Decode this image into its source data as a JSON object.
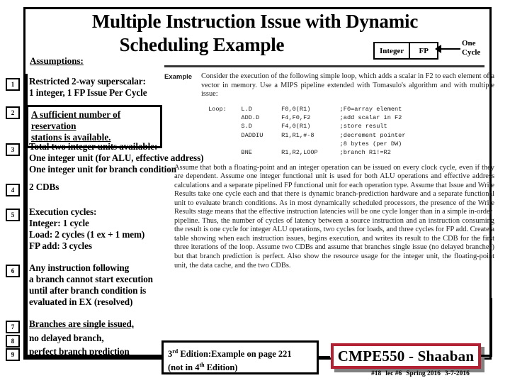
{
  "slide": {
    "title_line1": "Multiple Instruction Issue with Dynamic",
    "title_line2": "Scheduling Example",
    "assumptions_label": "Assumptions:"
  },
  "unit_box": {
    "integer_label": "Integer",
    "fp_label": "FP",
    "annotation_line1": "One",
    "annotation_line2": "Cycle"
  },
  "assumptions": [
    {
      "number": "1",
      "text": "Restricted 2-way superscalar:\n1 integer, 1 FP Issue Per Cycle",
      "boxed": false,
      "underlined": false
    },
    {
      "number": "2",
      "text": "A sufficient number of reservation\nstations is available.",
      "boxed": true,
      "underlined": true
    },
    {
      "number": "3",
      "text": "Total two integer units available:\nOne integer unit (for ALU, effective address)\nOne integer unit for branch condition",
      "boxed": false,
      "underlined": false
    },
    {
      "number": "4",
      "text": "2 CDBs",
      "boxed": false,
      "underlined": false
    },
    {
      "number": "5",
      "text": "Execution cycles:\nInteger:  1 cycle\nLoad:  2 cycles  (1 ex +  1 mem)\nFP add:  3 cycles",
      "boxed": false,
      "underlined": false
    },
    {
      "number": "6",
      "text": "Any instruction following\na branch cannot start execution\nuntil after branch condition is\nevaluated in EX (resolved)",
      "boxed": false,
      "underlined": false
    },
    {
      "number": "7",
      "text": "Branches are single issued,",
      "boxed": false,
      "underlined": true
    },
    {
      "number": "8",
      "text": "no delayed branch,",
      "boxed": false,
      "underlined": false
    },
    {
      "number": "9",
      "text": "perfect branch prediction",
      "boxed": false,
      "underlined": false
    }
  ],
  "excerpt": {
    "label": "Example",
    "intro": "Consider the execution of the following simple loop, which adds a scalar in F2 to each element of a vector in memory. Use a MIPS pipeline extended with Tomasulo's algorithm and with multiple issue:",
    "code": "Loop:    L.D        F0,0(R1)        ;F0=array element\n         ADD.D      F4,F0,F2        ;add scalar in F2\n         S.D        F4,0(R1)        ;store result\n         DADDIU     R1,R1,#-8       ;decrement pointer\n                                    ;8 bytes (per DW)\n         BNE        R1,R2,LOOP      ;branch R1!=R2",
    "paragraph1": "Assume that both a floating-point and an integer operation can be issued on every clock cycle, even if they are dependent. Assume one integer functional unit is used for both ALU operations and effective address calculations and a separate pipelined FP functional unit for each operation type. Assume that Issue and Write Results take one cycle each and that there is dynamic branch-prediction hardware and a separate functional unit to evaluate branch conditions. As in most dynamically scheduled processors, the presence of the Write Results stage means that the effective instruction latencies will be one cycle longer than in a simple in-order",
    "paragraph2": "pipeline. Thus, the number of cycles of latency between a source instruction and an instruction consuming the result is one cycle for integer ALU operations, two cycles for loads, and three cycles for FP add. Create a table showing when each instruction issues, begins execution, and writes its result to the CDB for the first three iterations of the loop. Assume two CDBs and assume that branches single issue (no delayed branches) but that branch prediction is perfect. Also show the resource usage for the integer unit, the floating-point unit, the data cache, and the two CDBs."
  },
  "edition_note": {
    "line1_pre": "3",
    "line1_sup": "rd",
    "line1_post": " Edition:Example on page 221",
    "line2_pre": "(not in 4",
    "line2_sup": "th",
    "line2_post": " Edition)"
  },
  "banner": {
    "text": "CMPE550 - Shaaban",
    "border_color": "#B22234"
  },
  "footer": {
    "slide_number": "#18",
    "lecture": "lec #6",
    "term": "Spring 2016",
    "date": "3-7-2016"
  }
}
